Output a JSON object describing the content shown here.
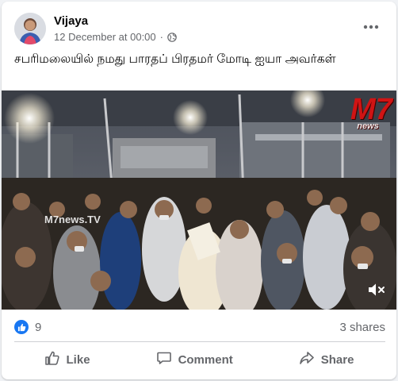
{
  "post": {
    "author": "Vijaya",
    "timestamp": "12 December at 00:00",
    "separator": "·",
    "audience_icon": "globe-icon",
    "caption": "சபரிமலையில் நமது பாரதப் பிரதமர் மோடி ஐயா அவர்கள்"
  },
  "video": {
    "logo_main": "M7",
    "logo_sub": "news",
    "overlay_text": "M7news.TV",
    "mute_icon": "volume-muted-icon"
  },
  "stats": {
    "reactions_count": "9",
    "shares": "3 shares"
  },
  "actions": {
    "like_label": "Like",
    "comment_label": "Comment",
    "share_label": "Share"
  },
  "colors": {
    "brand_blue": "#1877f2",
    "secondary_text": "#65676b",
    "logo_red": "#d01414"
  }
}
